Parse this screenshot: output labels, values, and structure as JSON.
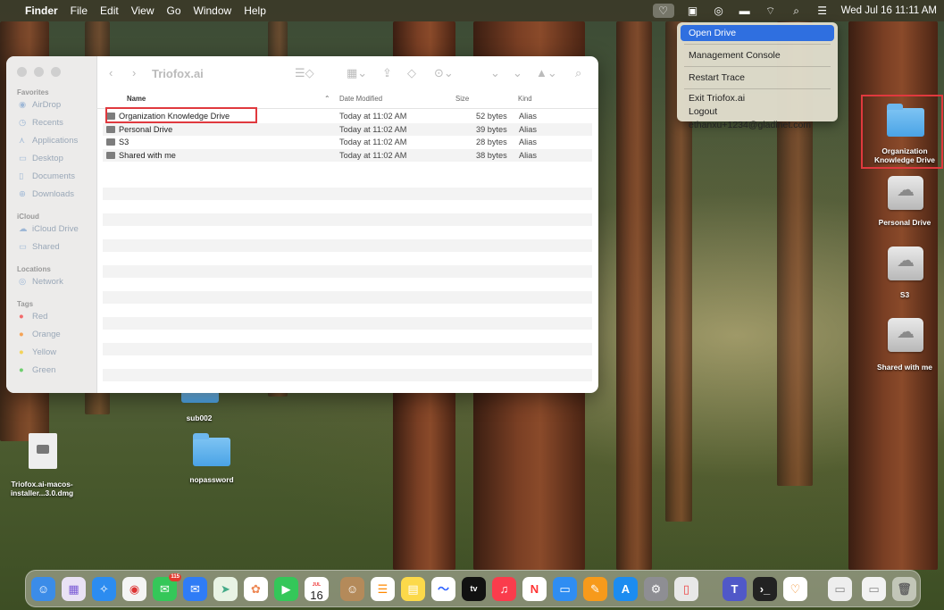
{
  "menubar": {
    "apple": "",
    "items": [
      "Finder",
      "File",
      "Edit",
      "View",
      "Go",
      "Window",
      "Help"
    ],
    "datetime": "Wed Jul 16  11:11 AM"
  },
  "dropdown": {
    "items": [
      "Open Drive",
      "Management Console",
      "Restart Trace",
      "Exit Triofox.ai"
    ],
    "logout": "Logout ethanxu+1234@gladinet.com"
  },
  "finder": {
    "title": "Triofox.ai",
    "sidebar": {
      "favorites_header": "Favorites",
      "favorites": [
        "AirDrop",
        "Recents",
        "Applications",
        "Desktop",
        "Documents",
        "Downloads"
      ],
      "icloud_header": "iCloud",
      "icloud": [
        "iCloud Drive",
        "Shared"
      ],
      "locations_header": "Locations",
      "locations": [
        "Network"
      ],
      "tags_header": "Tags",
      "tags": [
        {
          "name": "Red",
          "color": "#f26b6b"
        },
        {
          "name": "Orange",
          "color": "#f5a356"
        },
        {
          "name": "Yellow",
          "color": "#f3d35a"
        },
        {
          "name": "Green",
          "color": "#6fcf6f"
        }
      ]
    },
    "columns": {
      "name": "Name",
      "date": "Date Modified",
      "size": "Size",
      "kind": "Kind"
    },
    "rows": [
      {
        "name": "Organization Knowledge Drive",
        "date": "Today at 11:02 AM",
        "size": "52 bytes",
        "kind": "Alias"
      },
      {
        "name": "Personal Drive",
        "date": "Today at 11:02 AM",
        "size": "39 bytes",
        "kind": "Alias"
      },
      {
        "name": "S3",
        "date": "Today at 11:02 AM",
        "size": "28 bytes",
        "kind": "Alias"
      },
      {
        "name": "Shared with me",
        "date": "Today at 11:02 AM",
        "size": "38 bytes",
        "kind": "Alias"
      }
    ]
  },
  "desktop": {
    "right_icons": [
      "Organization Knowledge Drive",
      "Personal Drive",
      "S3",
      "Shared with me"
    ],
    "left_icons": {
      "dmg": "Triofox.ai-macos-installer...3.0.dmg",
      "folder1": "sub002",
      "folder2": "nopassword"
    }
  },
  "dock": {
    "calendar_month": "JUL",
    "calendar_day": "16",
    "messages_badge": "115",
    "tv_label": "tv"
  },
  "colors": {
    "highlight": "#e0393e",
    "menu_selected": "#2f6fe0",
    "folder": "#5fb2ee"
  }
}
